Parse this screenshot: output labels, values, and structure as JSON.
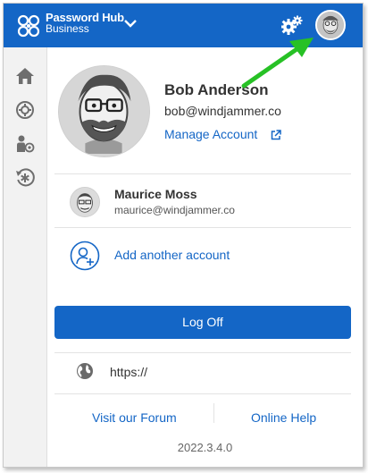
{
  "brand": {
    "name": "Password Hub",
    "sub": "Business"
  },
  "colors": {
    "primary": "#1466c6",
    "arrow": "#27c125",
    "sidebar_bg": "#f2f2f2"
  },
  "icons": {
    "logo": "password-hub-logo",
    "menu": "chevron-down-icon",
    "settings": "gears-icon",
    "sidebar": [
      "home-icon",
      "vault-settings-icon",
      "user-settings-icon",
      "asterisk-sync-icon"
    ],
    "external": "external-link-icon",
    "add_account": "add-user-icon",
    "server": "globe-icon"
  },
  "profile": {
    "name": "Bob Anderson",
    "email": "bob@windjammer.co",
    "manage_label": "Manage Account"
  },
  "accounts": [
    {
      "name": "Maurice Moss",
      "email": "maurice@windjammer.co"
    }
  ],
  "add_account_label": "Add another account",
  "logoff_label": "Log Off",
  "server_url": "https://",
  "footer": {
    "forum_label": "Visit our Forum",
    "help_label": "Online Help"
  },
  "version": "2022.3.4.0"
}
